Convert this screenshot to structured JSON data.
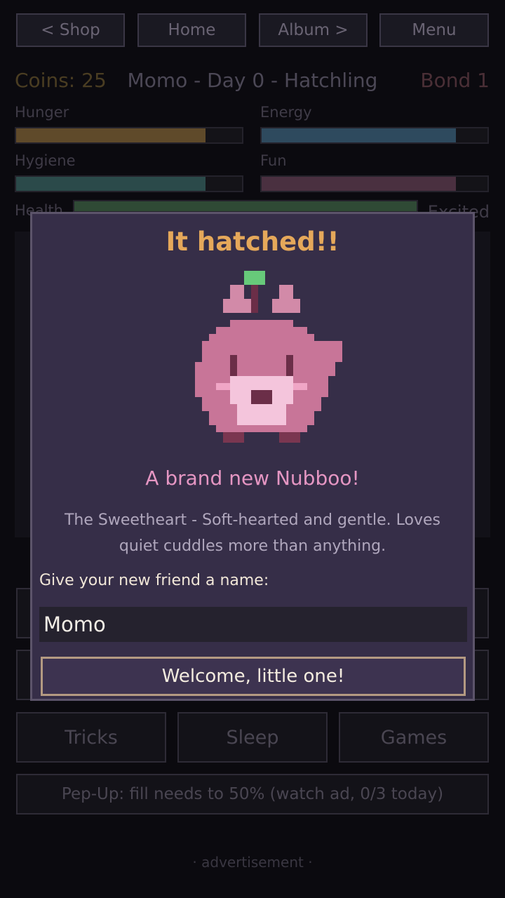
{
  "nav": {
    "shop": "< Shop",
    "home": "Home",
    "album": "Album >",
    "menu": "Menu"
  },
  "header": {
    "coins": "Coins: 25",
    "title": "Momo - Day 0 - Hatchling",
    "bond": "Bond 1"
  },
  "stats": {
    "hunger": {
      "label": "Hunger",
      "level": 0.84
    },
    "energy": {
      "label": "Energy",
      "level": 0.86
    },
    "hygiene": {
      "label": "Hygiene",
      "level": 0.84
    },
    "fun": {
      "label": "Fun",
      "level": 0.86
    },
    "health": {
      "label": "Health",
      "level": 1.0
    },
    "mood": "Excited"
  },
  "actions": {
    "tricks": "Tricks",
    "sleep": "Sleep",
    "games": "Games"
  },
  "pepup": "Pep-Up: fill needs to 50%  (watch ad, 0/3 today)",
  "ad": "· advertisement ·",
  "modal": {
    "title": "It hatched!!",
    "subtitle": "A brand new Nubboo!",
    "description": "The Sweetheart - Soft-hearted and gentle. Loves quiet cuddles more than anything.",
    "prompt": "Give your new friend a name:",
    "name_value": "Momo",
    "confirm": "Welcome, little one!"
  },
  "colors": {
    "hunger": "#5f4a2a",
    "energy": "#2e4a5e",
    "hygiene": "#2b4a4a",
    "fun": "#4a3040",
    "health": "#2f4a35",
    "accent": "#e5a85a",
    "pet": "#c87598"
  }
}
